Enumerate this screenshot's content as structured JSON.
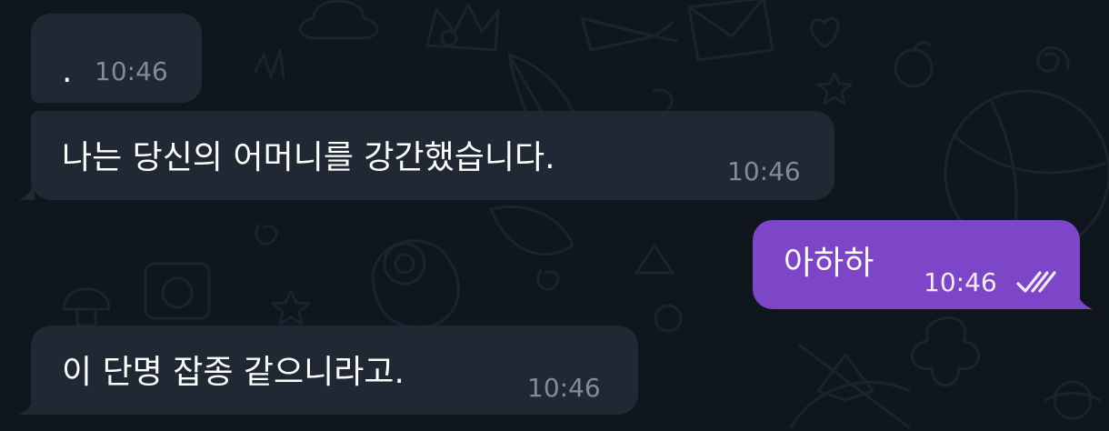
{
  "messages": [
    {
      "direction": "incoming",
      "text": "·",
      "time": "10:46"
    },
    {
      "direction": "incoming",
      "text": "나는 당신의 어머니를 강간했습니다.",
      "time": "10:46"
    },
    {
      "direction": "outgoing",
      "text": "아하하",
      "time": "10:46",
      "status_icon": "double-check-icon"
    },
    {
      "direction": "incoming",
      "text": "이 단명 잡종 같으니라고.",
      "time": "10:46"
    }
  ],
  "colors": {
    "background": "#10161d",
    "incoming_bubble": "#1f2833",
    "outgoing_bubble": "#7d46c9",
    "incoming_time": "#7f8c99",
    "outgoing_time": "#f2ecfb",
    "wallpaper_doodles": "#1b232c"
  }
}
